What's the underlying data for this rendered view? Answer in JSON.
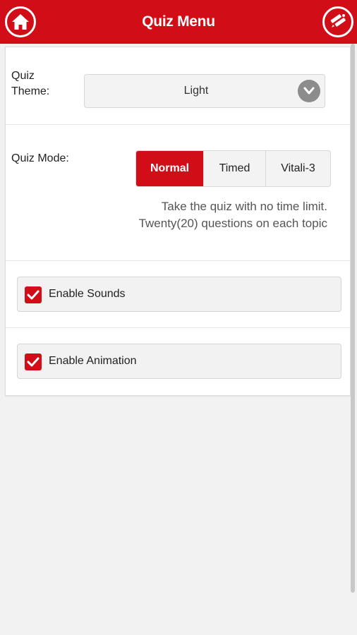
{
  "header": {
    "title": "Quiz Menu",
    "background": "#d10d17",
    "left_icon": "home-icon",
    "right_icon": "edit-icon"
  },
  "theme": {
    "label": "Quiz Theme:",
    "selected": "Light",
    "chevron_icon": "chevron-down-icon"
  },
  "mode": {
    "label": "Quiz Mode:",
    "options": [
      "Normal",
      "Timed",
      "Vitali-3"
    ],
    "selected": "Normal",
    "description_line1": "Take the quiz with no time limit.",
    "description_line2": "Twenty(20) questions on each topic"
  },
  "options": {
    "sounds": {
      "label": "Enable Sounds",
      "checked": true
    },
    "animation": {
      "label": "Enable Animation",
      "checked": true
    }
  },
  "colors": {
    "accent": "#d10d17",
    "page_bg": "#f2f2f2"
  }
}
